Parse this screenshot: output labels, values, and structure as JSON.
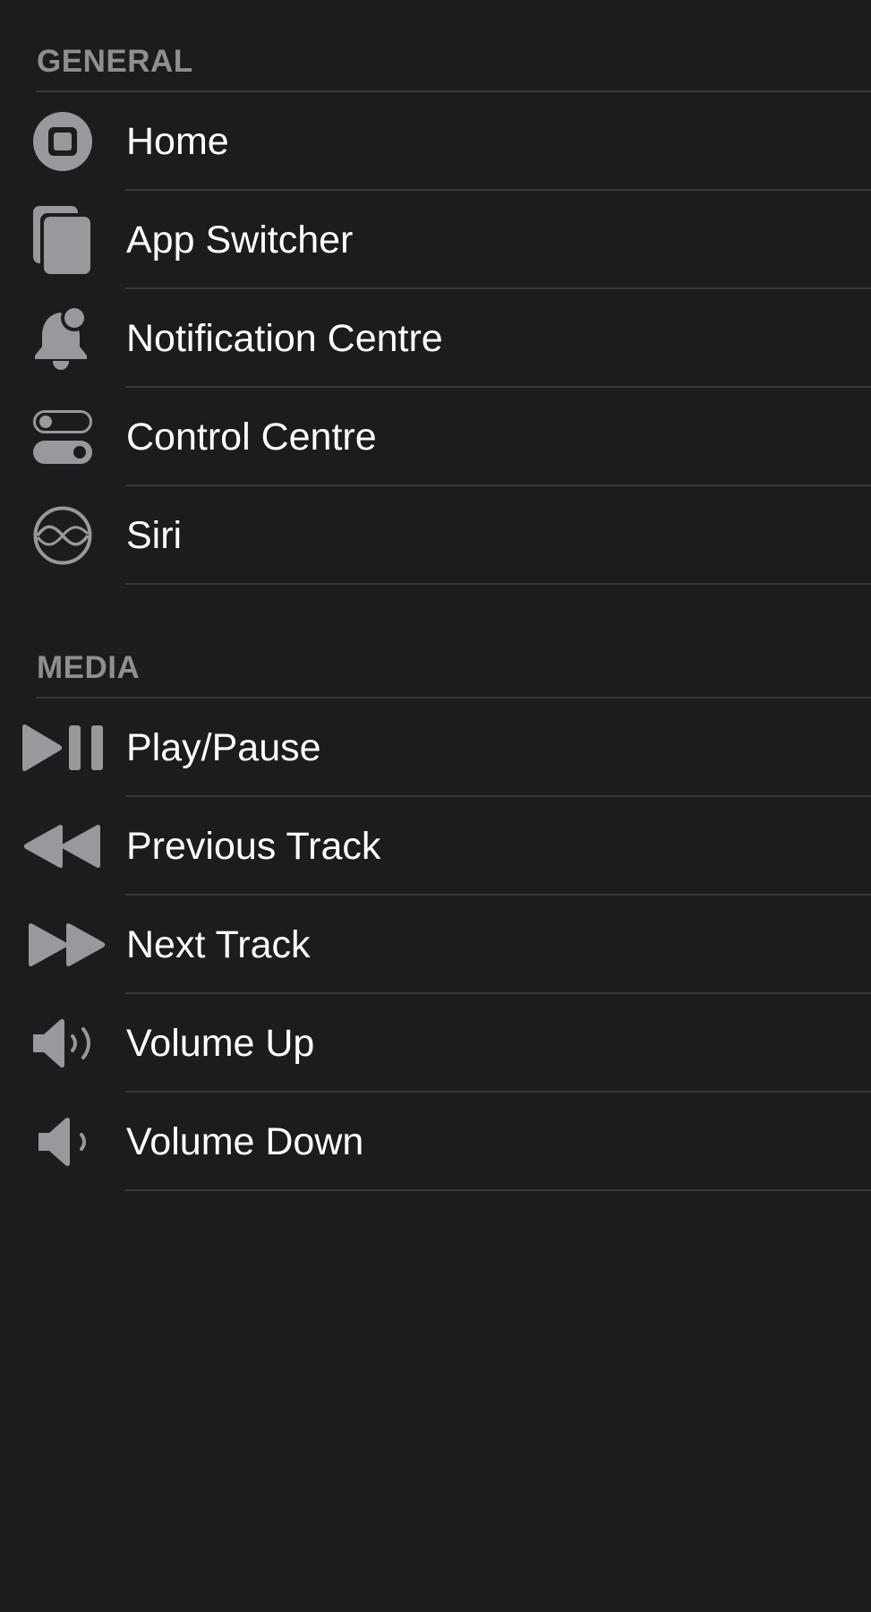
{
  "sections": [
    {
      "header": "GENERAL",
      "items": [
        {
          "label": "Home",
          "icon": "home-button-icon"
        },
        {
          "label": "App Switcher",
          "icon": "app-switcher-icon"
        },
        {
          "label": "Notification Centre",
          "icon": "bell-badge-icon"
        },
        {
          "label": "Control Centre",
          "icon": "toggles-icon"
        },
        {
          "label": "Siri",
          "icon": "siri-icon"
        }
      ]
    },
    {
      "header": "MEDIA",
      "items": [
        {
          "label": "Play/Pause",
          "icon": "play-pause-icon"
        },
        {
          "label": "Previous Track",
          "icon": "rewind-icon"
        },
        {
          "label": "Next Track",
          "icon": "fast-forward-icon"
        },
        {
          "label": "Volume Up",
          "icon": "speaker-wave-icon"
        },
        {
          "label": "Volume Down",
          "icon": "speaker-low-icon"
        }
      ]
    }
  ],
  "colors": {
    "background": "#1c1c1e",
    "text": "#ffffff",
    "icon": "#98989d",
    "header": "#8e8e93",
    "separator": "#38383a"
  }
}
